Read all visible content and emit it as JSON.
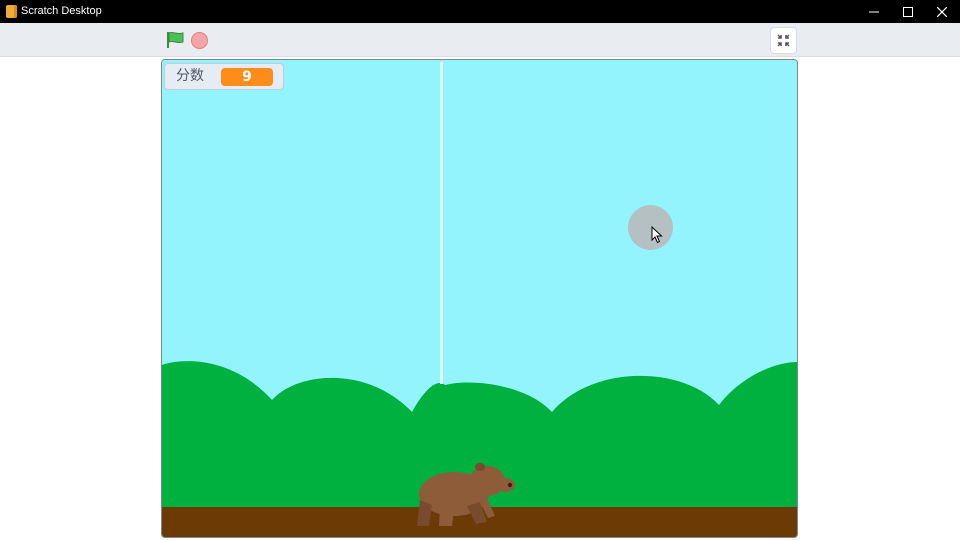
{
  "window": {
    "title": "Scratch Desktop",
    "controls": [
      "minimize",
      "maximize",
      "close"
    ]
  },
  "toolbar": {
    "green_flag": "green-flag-icon",
    "stop": "stop-icon",
    "fullscreen_toggle": "exit-fullscreen-icon"
  },
  "stage": {
    "monitor": {
      "label": "分数",
      "value": "9"
    },
    "colors": {
      "sky": "#93f4fe",
      "bushes": "#00b140",
      "ground": "#6b3a05",
      "monitor_value": "#ff8c1a"
    }
  }
}
